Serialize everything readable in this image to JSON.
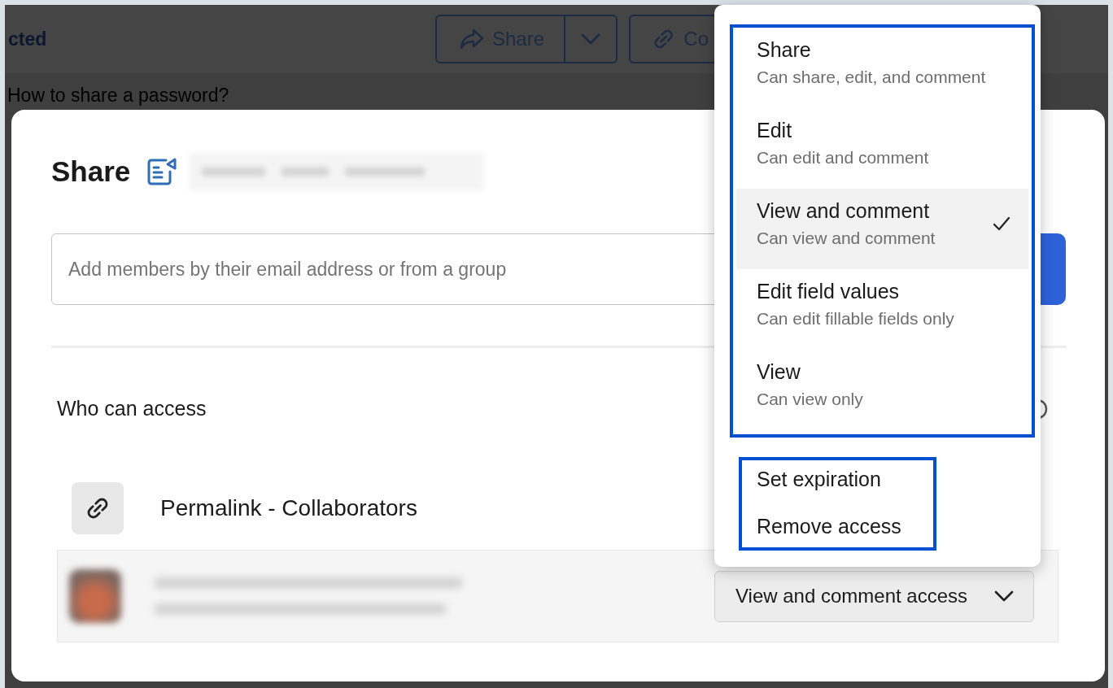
{
  "background": {
    "header_text": "cted",
    "share_button": "Share",
    "copy_button": "Co",
    "list_title": "How to share a password?"
  },
  "dialog": {
    "title": "Share",
    "input": {
      "placeholder": "Add members by their email address or from a group"
    },
    "section_title": "Who can access",
    "permalink": "Permalink - Collaborators",
    "member": {
      "access_button": "View and comment access"
    }
  },
  "menu": {
    "roles": [
      {
        "title": "Share",
        "description": "Can share, edit, and comment",
        "selected": false
      },
      {
        "title": "Edit",
        "description": "Can edit and comment",
        "selected": false
      },
      {
        "title": "View and comment",
        "description": "Can view and comment",
        "selected": true
      },
      {
        "title": "Edit field values",
        "description": "Can edit fillable fields only",
        "selected": false
      },
      {
        "title": "View",
        "description": "Can view only",
        "selected": false
      }
    ],
    "actions": [
      "Set expiration",
      "Remove access"
    ]
  }
}
